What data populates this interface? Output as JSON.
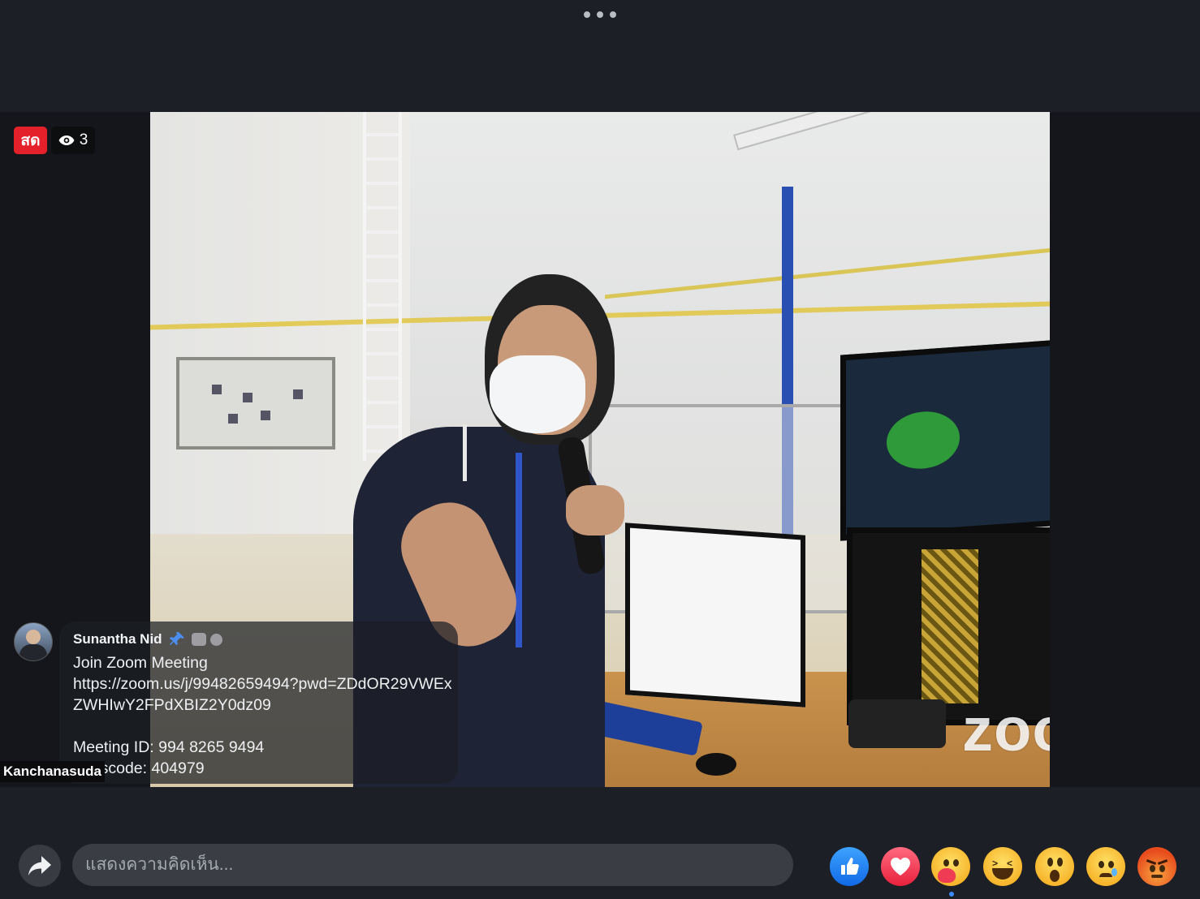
{
  "top_menu": {
    "icon": "more-horizontal-icon"
  },
  "live": {
    "badge_label": "สด",
    "viewer_count": "3",
    "viewer_icon": "eye-icon"
  },
  "comment": {
    "author": "Sunantha Nid",
    "pin_icon": "pin-icon",
    "text": "Join Zoom Meeting\nhttps://zoom.us/j/99482659494?pwd=ZDdOR29VWExZWHIwY2FPdXBIZ2Y0dz09\n\nMeeting ID: 994 8265 9494\nPasscode: 404979"
  },
  "video": {
    "participant_name": "Kanchanasuda",
    "watermark": "zoom"
  },
  "bottom_bar": {
    "share_icon": "share-arrow-icon",
    "comment_placeholder": "แสดงความคิดเห็น...",
    "reactions": [
      "like",
      "love",
      "care",
      "haha",
      "wow",
      "sad",
      "angry"
    ]
  },
  "colors": {
    "background": "#1c1f26",
    "live_red": "#e4212b",
    "like_blue": "#1877f2",
    "love_red": "#f33e58"
  }
}
